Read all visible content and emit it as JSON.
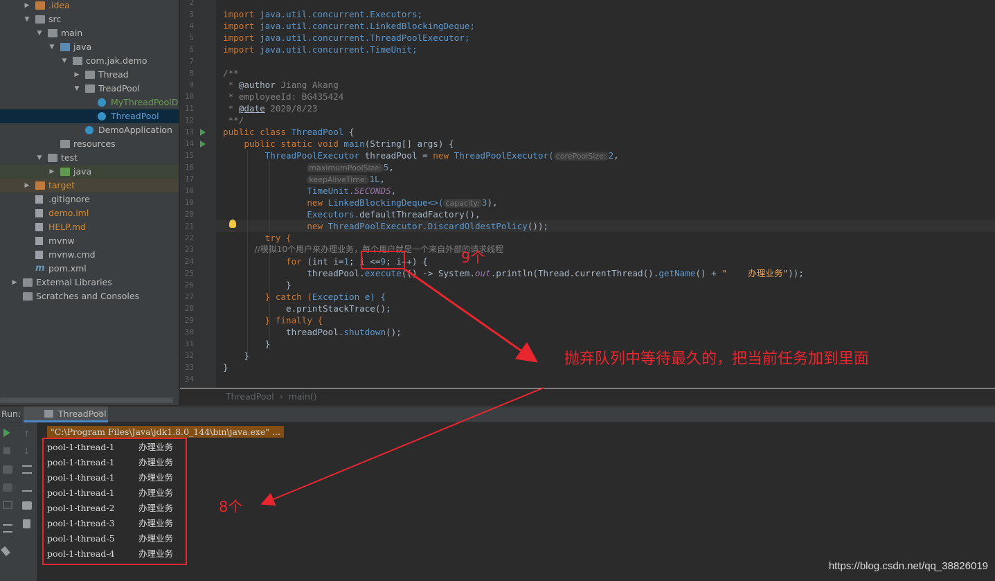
{
  "project_tree": {
    "items": [
      {
        "label": ".idea",
        "depth": 1,
        "arrow": "collapsed",
        "icon": "folder-icon",
        "color": "orange"
      },
      {
        "label": "src",
        "depth": 1,
        "arrow": "expanded",
        "icon": "folder-icon"
      },
      {
        "label": "main",
        "depth": 2,
        "arrow": "expanded",
        "icon": "folder-icon"
      },
      {
        "label": "java",
        "depth": 3,
        "arrow": "expanded",
        "icon": "source-folder-icon"
      },
      {
        "label": "com.jak.demo",
        "depth": 4,
        "arrow": "expanded",
        "icon": "package-icon"
      },
      {
        "label": "Thread",
        "depth": 5,
        "arrow": "collapsed",
        "icon": "package-icon"
      },
      {
        "label": "TreadPool",
        "depth": 5,
        "arrow": "expanded",
        "icon": "package-icon"
      },
      {
        "label": "MyThreadPoolDemo",
        "depth": 6,
        "icon": "java-class-icon",
        "color": "green"
      },
      {
        "label": "ThreadPool",
        "depth": 6,
        "icon": "java-class-icon",
        "color": "blue",
        "selected": true
      },
      {
        "label": "DemoApplication",
        "depth": 5,
        "icon": "spring-class-icon"
      },
      {
        "label": "resources",
        "depth": 3,
        "icon": "resources-folder-icon"
      },
      {
        "label": "test",
        "depth": 2,
        "arrow": "expanded",
        "icon": "folder-icon"
      },
      {
        "label": "java",
        "depth": 3,
        "arrow": "collapsed",
        "icon": "test-folder-icon",
        "highlight": "test"
      },
      {
        "label": "target",
        "depth": 1,
        "arrow": "collapsed",
        "icon": "excluded-folder-icon",
        "color": "orange",
        "highlight": "excluded"
      },
      {
        "label": ".gitignore",
        "depth": 1,
        "icon": "file-icon"
      },
      {
        "label": "demo.iml",
        "depth": 1,
        "icon": "iml-file-icon",
        "color": "orange"
      },
      {
        "label": "HELP.md",
        "depth": 1,
        "icon": "markdown-file-icon",
        "color": "orange"
      },
      {
        "label": "mvnw",
        "depth": 1,
        "icon": "file-icon"
      },
      {
        "label": "mvnw.cmd",
        "depth": 1,
        "icon": "file-icon"
      },
      {
        "label": "pom.xml",
        "depth": 1,
        "icon": "maven-icon"
      },
      {
        "label": "External Libraries",
        "depth": 0,
        "arrow": "collapsed",
        "icon": "libraries-icon"
      },
      {
        "label": "Scratches and Consoles",
        "depth": 0,
        "icon": "scratches-icon"
      }
    ]
  },
  "editor": {
    "line_numbers": [
      "2",
      "3",
      "4",
      "5",
      "6",
      "7",
      "8",
      "9",
      "10",
      "11",
      "12",
      "13",
      "14",
      "15",
      "16",
      "17",
      "18",
      "19",
      "20",
      "21",
      "22",
      "23",
      "24",
      "25",
      "26",
      "27",
      "28",
      "29",
      "30",
      "31",
      "32",
      "33",
      "34"
    ],
    "lines": {
      "l3_import": "import",
      "l3_rest": " java.util.concurrent.Executors;",
      "l4_import": "import",
      "l4_rest": " java.util.concurrent.LinkedBlockingDeque;",
      "l5_import": "import",
      "l5_rest": " java.util.concurrent.ThreadPoolExecutor;",
      "l6_import": "import",
      "l6_rest": " java.util.concurrent.TimeUnit;",
      "l8": "/**",
      "l9_a": " * ",
      "l9_tag": "@author",
      "l9_b": " Jiang Akang",
      "l10": " * employeeId: BG435424",
      "l11_a": " * ",
      "l11_tag": "@date",
      "l11_b": " 2020/8/23",
      "l12": " **/",
      "l13_kw": "public class ",
      "l13_name": "ThreadPool",
      "l13_end": " {",
      "l14_kw": "    public static void ",
      "l14_name": "main",
      "l14_end": "(String[] args) {",
      "l15_type": "        ThreadPoolExecutor",
      "l15_var": " threadPool = ",
      "l15_new": "new ",
      "l15_ctor": "ThreadPoolExecutor(",
      "l15_hint": "corePoolSize:",
      "l15_val": "2",
      "l15_end": ",",
      "l16_hint": "maximumPoolSize:",
      "l16_val": "5",
      "l16_end": ",",
      "l17_hint": "keepAliveTime:",
      "l17_val": "1L",
      "l17_end": ",",
      "l18_a": "TimeUnit.",
      "l18_b": "SECONDS",
      "l18_c": ",",
      "l19_new": "new ",
      "l19_ctor": "LinkedBlockingDeque<>(",
      "l19_hint": "capacity:",
      "l19_val": "3",
      "l19_end": "),",
      "l20_a": "Executors.",
      "l20_b": "defaultThreadFactory",
      "l20_c": "(),",
      "l21_new": "new ",
      "l21_ctor": "ThreadPoolExecutor.DiscardOldestPolicy",
      "l21_end": "());",
      "l22": "        try {",
      "l23": "            //模拟10个用户来办理业务，每个用户就是一个来自外部的请求线程",
      "l24_for": "            for ",
      "l24_a": "(int i=",
      "l24_one": "1",
      "l24_b": "; i <=",
      "l24_nine": "9",
      "l24_c": "; i++) {",
      "l25_a": "                threadPool.",
      "l25_exec": "execute",
      "l25_b": "(() -> System.",
      "l25_out": "out",
      "l25_c": ".println(Thread.currentThread().",
      "l25_get": "getName",
      "l25_d": "() + ",
      "l25_str": "\"    办理业务\"",
      "l25_e": "));",
      "l26": "            }",
      "l27_a": "        } catch (",
      "l27_b": "Exception e) {",
      "l28_a": "            e.",
      "l28_b": "printStackTrace",
      "l28_c": "();",
      "l29_a": "        } finally {",
      "l30_a": "            threadPool.",
      "l30_b": "shutdown",
      "l30_c": "();",
      "l31": "        }",
      "l32": "    }",
      "l33": "}"
    },
    "breadcrumb": [
      "ThreadPool",
      "main()"
    ]
  },
  "run_panel": {
    "label": "Run:",
    "tab_label": "ThreadPool",
    "command": "\"C:\\Program Files\\Java\\jdk1.8.0_144\\bin\\java.exe\" ...",
    "output": [
      {
        "thread": "pool-1-thread-1",
        "msg": "办理业务"
      },
      {
        "thread": "pool-1-thread-1",
        "msg": "办理业务"
      },
      {
        "thread": "pool-1-thread-1",
        "msg": "办理业务"
      },
      {
        "thread": "pool-1-thread-1",
        "msg": "办理业务"
      },
      {
        "thread": "pool-1-thread-2",
        "msg": "办理业务"
      },
      {
        "thread": "pool-1-thread-3",
        "msg": "办理业务"
      },
      {
        "thread": "pool-1-thread-5",
        "msg": "办理业务"
      },
      {
        "thread": "pool-1-thread-4",
        "msg": "办理业务"
      }
    ]
  },
  "annotations": {
    "nine_label": "9个",
    "eight_label": "8个",
    "policy_note": "抛弃队列中等待最久的，把当前任务加到里面",
    "color": "#e8262e"
  },
  "watermark": "https://blog.csdn.net/qq_38826019"
}
